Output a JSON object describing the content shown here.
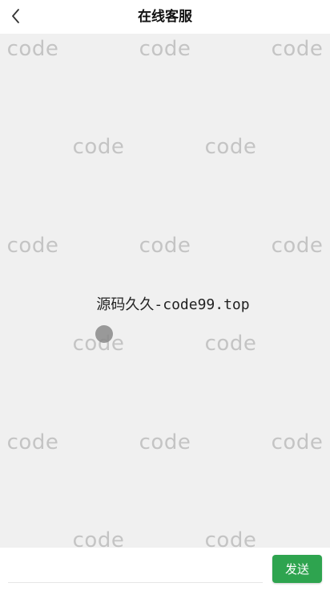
{
  "header": {
    "title": "在线客服",
    "back_icon": "chevron-left-icon"
  },
  "chat": {
    "watermark_text": "code",
    "center_text": "源码久久-code99.top",
    "background_color": "#f0f0f0",
    "watermark_color": "#c4c4c4"
  },
  "composer": {
    "input_value": "",
    "input_placeholder": "",
    "send_label": "发送",
    "send_color": "#2ea44f"
  }
}
